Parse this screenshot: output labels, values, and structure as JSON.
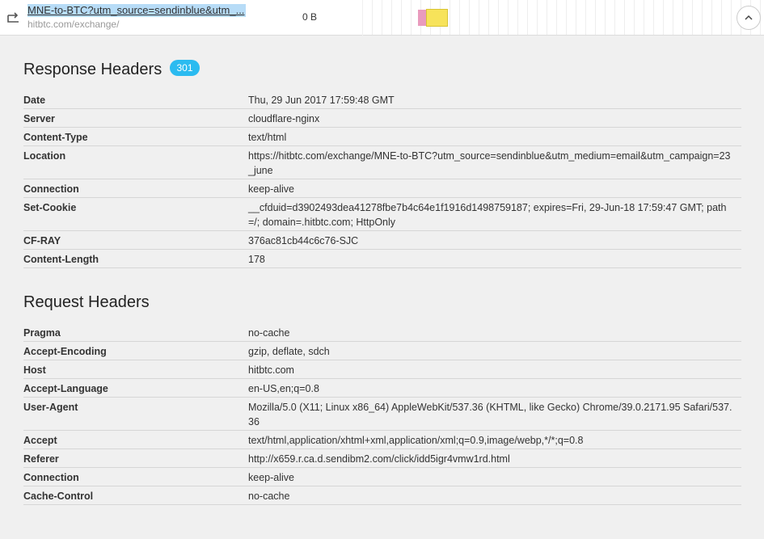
{
  "request": {
    "url": "MNE-to-BTC?utm_source=sendinblue&utm_...",
    "host": "hitbtc.com/exchange/",
    "size": "0 B"
  },
  "response": {
    "title": "Response Headers",
    "status": "301",
    "headers": [
      {
        "name": "Date",
        "value": "Thu, 29 Jun 2017 17:59:48 GMT"
      },
      {
        "name": "Server",
        "value": "cloudflare-nginx"
      },
      {
        "name": "Content-Type",
        "value": "text/html"
      },
      {
        "name": "Location",
        "value": "https://hitbtc.com/exchange/MNE-to-BTC?utm_source=sendinblue&utm_medium=email&utm_campaign=23_june"
      },
      {
        "name": "Connection",
        "value": "keep-alive"
      },
      {
        "name": "Set-Cookie",
        "value": "__cfduid=d3902493dea41278fbe7b4c64e1f1916d1498759187; expires=Fri, 29-Jun-18 17:59:47 GMT; path=/; domain=.hitbtc.com; HttpOnly"
      },
      {
        "name": "CF-RAY",
        "value": "376ac81cb44c6c76-SJC"
      },
      {
        "name": "Content-Length",
        "value": "178"
      }
    ]
  },
  "request_headers": {
    "title": "Request Headers",
    "headers": [
      {
        "name": "Pragma",
        "value": "no-cache"
      },
      {
        "name": "Accept-Encoding",
        "value": "gzip, deflate, sdch"
      },
      {
        "name": "Host",
        "value": "hitbtc.com"
      },
      {
        "name": "Accept-Language",
        "value": "en-US,en;q=0.8"
      },
      {
        "name": "User-Agent",
        "value": "Mozilla/5.0 (X11; Linux x86_64) AppleWebKit/537.36 (KHTML, like Gecko) Chrome/39.0.2171.95 Safari/537.36"
      },
      {
        "name": "Accept",
        "value": "text/html,application/xhtml+xml,application/xml;q=0.9,image/webp,*/*;q=0.8"
      },
      {
        "name": "Referer",
        "value": "http://x659.r.ca.d.sendibm2.com/click/idd5igr4vmw1rd.html"
      },
      {
        "name": "Connection",
        "value": "keep-alive"
      },
      {
        "name": "Cache-Control",
        "value": "no-cache"
      }
    ]
  },
  "icons": {
    "redirect": "redirect-icon",
    "collapse": "chevron-up-icon"
  },
  "colors": {
    "badge": "#2bbbf0",
    "timeline_blocked": "#e99bbd",
    "timeline_waiting": "#f7e35a"
  }
}
